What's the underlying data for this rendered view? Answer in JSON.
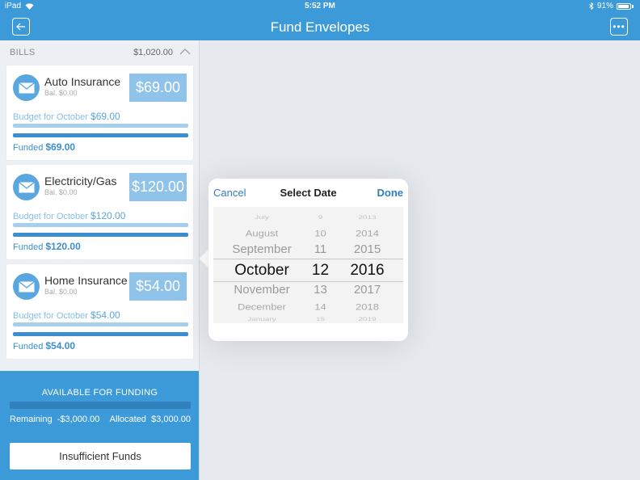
{
  "status_bar": {
    "device": "iPad",
    "time": "5:52 PM",
    "battery": "91%"
  },
  "nav": {
    "title": "Fund Envelopes",
    "back_icon": "arrow-left-icon",
    "more_icon": "ellipsis-icon"
  },
  "section": {
    "label": "BILLS",
    "total": "$1,020.00"
  },
  "envelopes": [
    {
      "name": "Auto Insurance",
      "balance": "Bal. $0.00",
      "amount": "$69.00",
      "budget_label": "Budget for October",
      "budget_value": "$69.00",
      "funded_label": "Funded",
      "funded_value": "$69.00"
    },
    {
      "name": "Electricity/Gas",
      "balance": "Bal. $0.00",
      "amount": "$120.00",
      "budget_label": "Budget for October",
      "budget_value": "$120.00",
      "funded_label": "Funded",
      "funded_value": "$120.00"
    },
    {
      "name": "Home Insurance",
      "balance": "Bal. $0.00",
      "amount": "$54.00",
      "budget_label": "Budget for October",
      "budget_value": "$54.00",
      "funded_label": "Funded",
      "funded_value": "$54.00"
    }
  ],
  "funding": {
    "heading": "AVAILABLE FOR FUNDING",
    "remaining_label": "Remaining",
    "remaining_value": "-$3,000.00",
    "allocated_label": "Allocated",
    "allocated_value": "$3,000.00",
    "button": "Insufficient Funds"
  },
  "date_picker": {
    "cancel": "Cancel",
    "title": "Select Date",
    "done": "Done",
    "months": [
      "July",
      "August",
      "September",
      "October",
      "November",
      "December",
      "January"
    ],
    "days": [
      "9",
      "10",
      "11",
      "12",
      "13",
      "14",
      "15"
    ],
    "years": [
      "2013",
      "2014",
      "2015",
      "2016",
      "2017",
      "2018",
      "2019"
    ],
    "selected": {
      "month": "October",
      "day": "12",
      "year": "2016"
    }
  },
  "colors": {
    "accent": "#3d9ad9",
    "link": "#2f7fc2",
    "amount_box": "#8fc3ea",
    "funded_bar": "#3b8fd0"
  }
}
